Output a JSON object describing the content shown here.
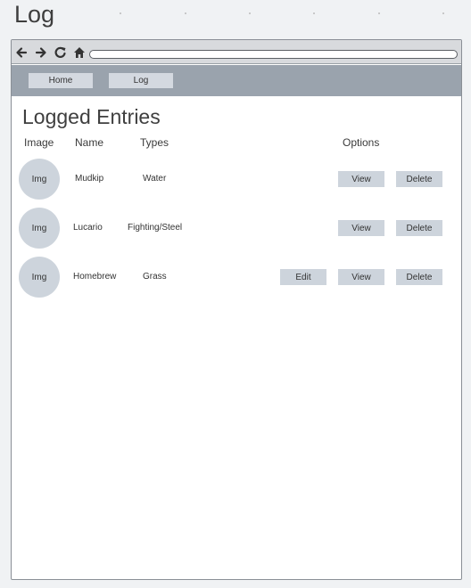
{
  "page": {
    "title": "Log"
  },
  "navbar": {
    "home_label": "Home",
    "log_label": "Log"
  },
  "main": {
    "title": "Logged Entries",
    "columns": {
      "image": "Image",
      "name": "Name",
      "types": "Types",
      "options": "Options"
    },
    "rows": [
      {
        "img": "Img",
        "name": "Mudkip",
        "types": "Water",
        "edit": null,
        "view": "View",
        "delete": "Delete"
      },
      {
        "img": "Img",
        "name": "Lucario",
        "types": "Fighting/Steel",
        "edit": null,
        "view": "View",
        "delete": "Delete"
      },
      {
        "img": "Img",
        "name": "Homebrew",
        "types": "Grass",
        "edit": "Edit",
        "view": "View",
        "delete": "Delete"
      }
    ]
  },
  "colors": {
    "navbar": "#9aa3ad",
    "button": "#cdd4dc",
    "avatar": "#cdd4dc",
    "toolbar": "#d8dadd"
  },
  "icons": [
    "back-arrow-icon",
    "forward-arrow-icon",
    "reload-icon",
    "home-icon"
  ]
}
